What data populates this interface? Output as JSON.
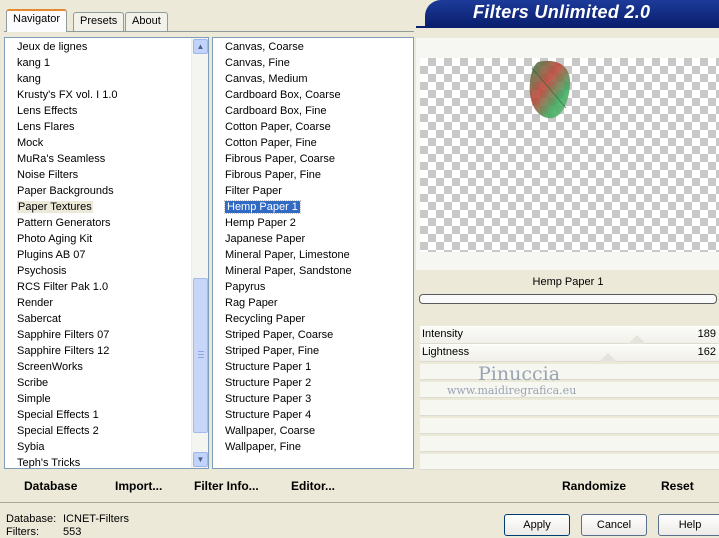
{
  "tabs": [
    {
      "label": "Navigator",
      "active": true
    },
    {
      "label": "Presets",
      "active": false
    },
    {
      "label": "About",
      "active": false
    }
  ],
  "app_title": "Filters Unlimited 2.0",
  "categories": [
    "Jeux de lignes",
    "kang 1",
    "kang",
    "Krusty's FX vol. I 1.0",
    "Lens Effects",
    "Lens Flares",
    "Mock",
    "MuRa's Seamless",
    "Noise Filters",
    "Paper Backgrounds",
    "Paper Textures",
    "Pattern Generators",
    "Photo Aging Kit",
    "Plugins AB 07",
    "Psychosis",
    "RCS Filter Pak 1.0",
    "Render",
    "Sabercat",
    "Sapphire Filters 07",
    "Sapphire Filters 12",
    "ScreenWorks",
    "Scribe",
    "Simple",
    "Special Effects 1",
    "Special Effects 2",
    "Sybia",
    "Teph's Tricks"
  ],
  "selected_category": "Paper Textures",
  "filters": [
    "Canvas, Coarse",
    "Canvas, Fine",
    "Canvas, Medium",
    "Cardboard Box, Coarse",
    "Cardboard Box, Fine",
    "Cotton Paper, Coarse",
    "Cotton Paper, Fine",
    "Fibrous Paper, Coarse",
    "Fibrous Paper, Fine",
    "Filter Paper",
    "Hemp Paper 1",
    "Hemp Paper 2",
    "Japanese Paper",
    "Mineral Paper, Limestone",
    "Mineral Paper, Sandstone",
    "Papyrus",
    "Rag Paper",
    "Recycling Paper",
    "Striped Paper, Coarse",
    "Striped Paper, Fine",
    "Structure Paper 1",
    "Structure Paper 2",
    "Structure Paper 3",
    "Structure Paper 4",
    "Wallpaper, Coarse",
    "Wallpaper, Fine"
  ],
  "selected_filter": "Hemp Paper 1",
  "current_filter_name": "Hemp Paper 1",
  "params": [
    {
      "label": "Intensity",
      "value": "189",
      "level": 189
    },
    {
      "label": "Lightness",
      "value": "162",
      "level": 162
    }
  ],
  "bottom_buttons": {
    "database": "Database",
    "import": "Import...",
    "filter_info": "Filter Info...",
    "editor": "Editor...",
    "randomize": "Randomize",
    "reset": "Reset"
  },
  "status": {
    "database_label": "Database:",
    "database_value": "ICNET-Filters",
    "filters_label": "Filters:",
    "filters_value": "553"
  },
  "dialog_buttons": {
    "apply": "Apply",
    "cancel": "Cancel",
    "help": "Help"
  },
  "watermark": {
    "name": "Pinuccia",
    "url": "www.maidiregrafica.eu"
  }
}
